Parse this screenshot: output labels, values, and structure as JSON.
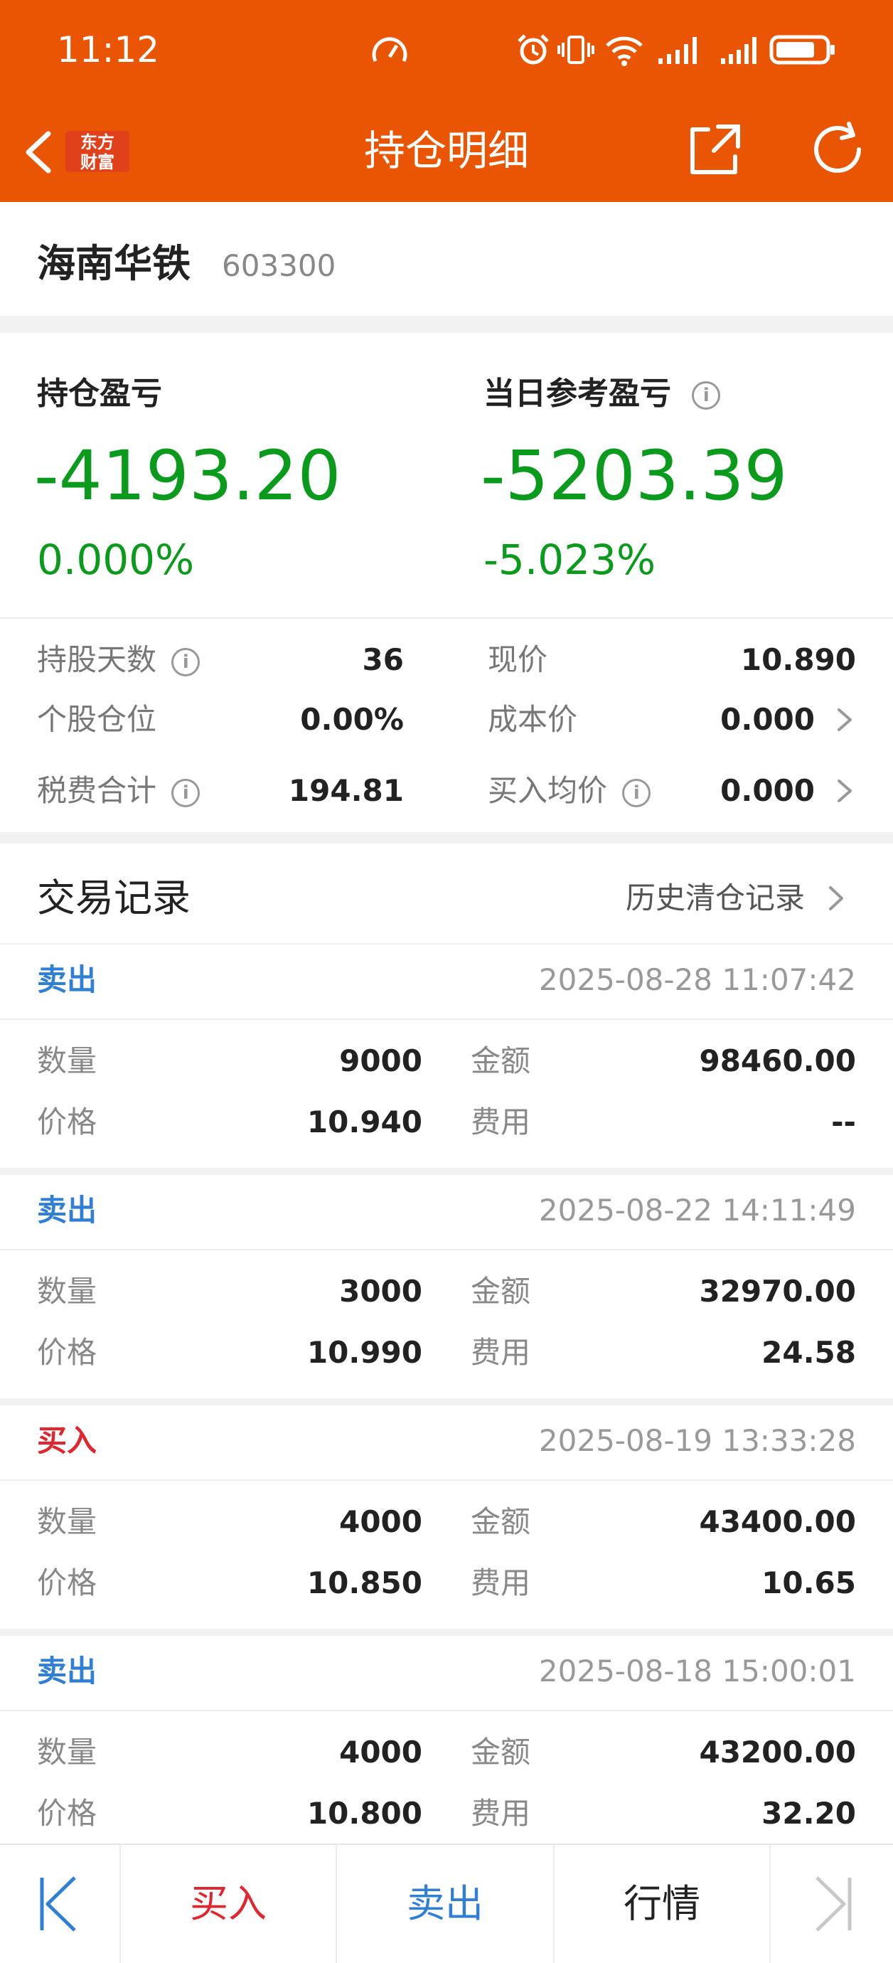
{
  "status_bar": {
    "time": "11:12",
    "battery_level": 0.8
  },
  "nav": {
    "title": "持仓明细",
    "logo_text_line1": "东方",
    "logo_text_line2": "财富"
  },
  "stock": {
    "name": "海南华铁",
    "code": "603300"
  },
  "pnl": {
    "position_label": "持仓盈亏",
    "position_value": "-4193.20",
    "position_pct": "0.000%",
    "daily_label": "当日参考盈亏",
    "daily_value": "-5203.39",
    "daily_pct": "-5.023%",
    "value_color": "#0a9a1c"
  },
  "stats": [
    {
      "label": "持股天数",
      "value": "36"
    },
    {
      "label": "现价",
      "value": "10.890"
    },
    {
      "label": "个股仓位",
      "value": "0.00%"
    },
    {
      "label": "成本价",
      "value": "0.000"
    },
    {
      "label": "税费合计",
      "value": "194.81"
    },
    {
      "label": "买入均价",
      "value": "0.000"
    }
  ],
  "records": {
    "title": "交易记录",
    "history_link": "历史清仓记录",
    "qty_label": "数量",
    "amount_label": "金额",
    "price_label": "价格",
    "fee_label": "费用",
    "colors": {
      "sell": "#2f7fd6",
      "buy": "#e0262e"
    },
    "items": [
      {
        "type": "卖出",
        "time": "2025-08-28 11:07:42",
        "qty": "9000",
        "amount": "98460.00",
        "price": "10.940",
        "fee": "--"
      },
      {
        "type": "卖出",
        "time": "2025-08-22 14:11:49",
        "qty": "3000",
        "amount": "32970.00",
        "price": "10.990",
        "fee": "24.58"
      },
      {
        "type": "买入",
        "time": "2025-08-19 13:33:28",
        "qty": "4000",
        "amount": "43400.00",
        "price": "10.850",
        "fee": "10.65"
      },
      {
        "type": "卖出",
        "time": "2025-08-18 15:00:01",
        "qty": "4000",
        "amount": "43200.00",
        "price": "10.800",
        "fee": "32.20"
      }
    ]
  },
  "bottom_bar": {
    "buy": "买入",
    "sell": "卖出",
    "market": "行情"
  }
}
